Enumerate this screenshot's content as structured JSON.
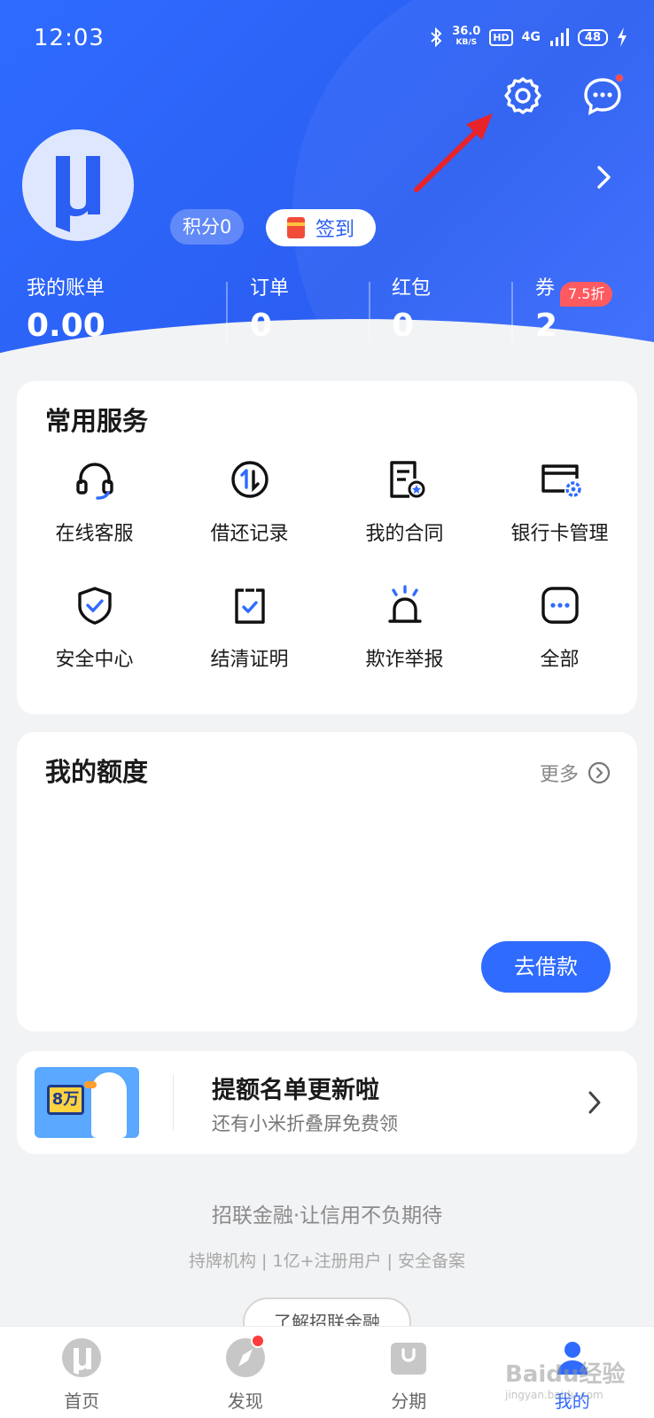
{
  "status_bar": {
    "time": "12:03",
    "speed_value": "36.0",
    "speed_unit": "KB/S",
    "hd": "HD",
    "network": "4G",
    "battery": "48"
  },
  "profile": {
    "points_label": "积分0",
    "checkin_label": "签到"
  },
  "stats": [
    {
      "label": "我的账单",
      "value": "0.00"
    },
    {
      "label": "订单",
      "value": "0"
    },
    {
      "label": "红包",
      "value": "0"
    },
    {
      "label": "券",
      "value": "2",
      "badge": "7.5折"
    }
  ],
  "services": {
    "title": "常用服务",
    "items": [
      {
        "label": "在线客服",
        "icon": "headset-icon"
      },
      {
        "label": "借还记录",
        "icon": "exchange-icon"
      },
      {
        "label": "我的合同",
        "icon": "contract-icon"
      },
      {
        "label": "银行卡管理",
        "icon": "bank-card-settings-icon"
      },
      {
        "label": "安全中心",
        "icon": "shield-check-icon"
      },
      {
        "label": "结清证明",
        "icon": "clipboard-check-icon"
      },
      {
        "label": "欺诈举报",
        "icon": "alarm-light-icon"
      },
      {
        "label": "全部",
        "icon": "more-dots-icon"
      }
    ]
  },
  "quota": {
    "title": "我的额度",
    "more_label": "更多",
    "borrow_label": "去借款"
  },
  "promo": {
    "image_text": "8万",
    "title": "提额名单更新啦",
    "subtitle": "还有小米折叠屏免费领"
  },
  "footer": {
    "slogan": "招联金融·让信用不负期待",
    "tagline": "持牌机构 | 1亿+注册用户 | 安全备案",
    "learn_more": "了解招联金融"
  },
  "bottom_nav": [
    {
      "label": "首页",
      "icon": "home-logo-icon"
    },
    {
      "label": "发现",
      "icon": "compass-icon"
    },
    {
      "label": "分期",
      "icon": "shopping-bag-icon"
    },
    {
      "label": "我的",
      "icon": "profile-icon"
    }
  ],
  "watermark": {
    "text": "Baidu经验",
    "sub": "jingyan.baidu.com"
  },
  "colors": {
    "primary": "#2f6bff",
    "danger": "#ff4d4f",
    "background": "#f2f3f5"
  }
}
